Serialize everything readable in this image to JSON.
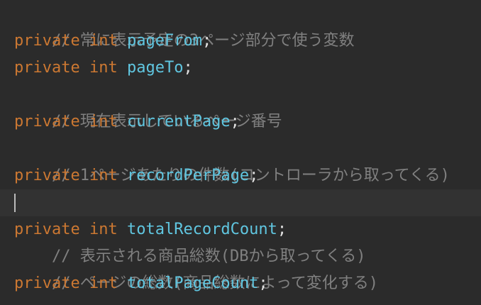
{
  "editor": {
    "lines": [
      {
        "kind": "comment",
        "text": "// 常に表示予定の3ページ部分で使う変数"
      },
      {
        "kind": "code",
        "modifier": "private",
        "type": "int",
        "name": "pageFrom",
        "semi": ";"
      },
      {
        "kind": "code",
        "modifier": "private",
        "type": "int",
        "name": "pageTo",
        "semi": ";"
      },
      {
        "kind": "comment",
        "text": "// 現在表示しているページ番号"
      },
      {
        "kind": "code",
        "modifier": "private",
        "type": "int",
        "name": "currentPage",
        "semi": ";"
      },
      {
        "kind": "comment",
        "text": "// 1ページあたりの件数(コントローラから取ってくる)"
      },
      {
        "kind": "code",
        "modifier": "private",
        "type": "int",
        "name": "recordPerPage",
        "semi": ";"
      },
      {
        "kind": "comment",
        "text": "// 表示される商品総数(DBから取ってくる)"
      },
      {
        "kind": "code",
        "modifier": "private",
        "type": "int",
        "name": "totalRecordCount",
        "semi": ";"
      },
      {
        "kind": "comment",
        "text": "// ページの総数(商品総数によって変化する)"
      },
      {
        "kind": "code",
        "modifier": "private",
        "type": "int",
        "name": "totalPageCount",
        "semi": ";"
      }
    ]
  },
  "colors": {
    "background": "#2b2b2b",
    "current_line": "#323232",
    "comment": "#808080",
    "keyword": "#cc7832",
    "field": "#60c6e0",
    "punctuation": "#e0e0e0"
  }
}
